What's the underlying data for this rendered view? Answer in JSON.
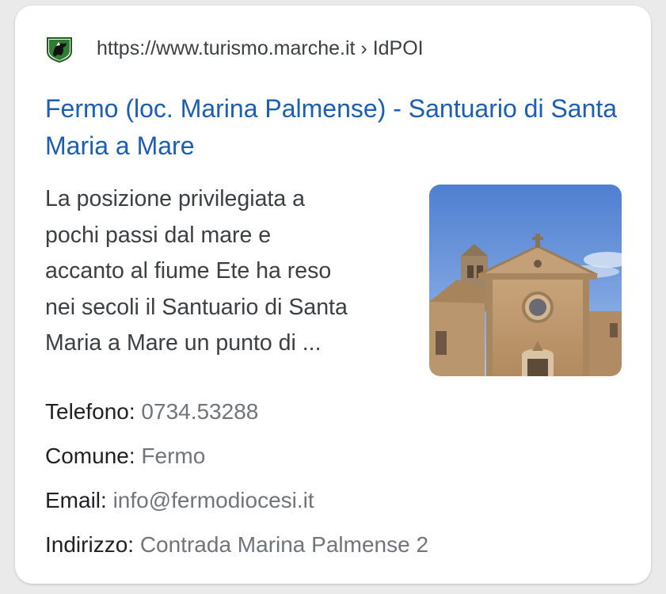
{
  "result": {
    "favicon": {
      "icon": "marche-region-logo-icon",
      "colors": [
        "#2e7d32",
        "#111111"
      ]
    },
    "url": "https://www.turismo.marche.it › IdPOI",
    "title": "Fermo (loc. Marina Palmense) - Santuario di Santa Maria a Mare",
    "snippet_lines": [
      "La posizione privilegiata a",
      "pochi passi dal mare e",
      "accanto al fiume Ete ha reso",
      "nei secoli il Santuario di Santa",
      "Maria a Mare un punto di  ..."
    ],
    "thumbnail": {
      "icon": "church-facade-photo"
    },
    "facts": [
      {
        "label": "Telefono:",
        "value": " 0734.53288"
      },
      {
        "label": "Comune:",
        "value": " Fermo"
      },
      {
        "label": "Email:",
        "value": " info@fermodiocesi.it"
      },
      {
        "label": "Indirizzo:",
        "value": " Contrada Marina Palmense 2"
      }
    ]
  },
  "colors": {
    "title_link": "#1a5fb4",
    "body_text": "#3c4043",
    "fact_value": "#70757a",
    "background": "#eaeaea"
  }
}
